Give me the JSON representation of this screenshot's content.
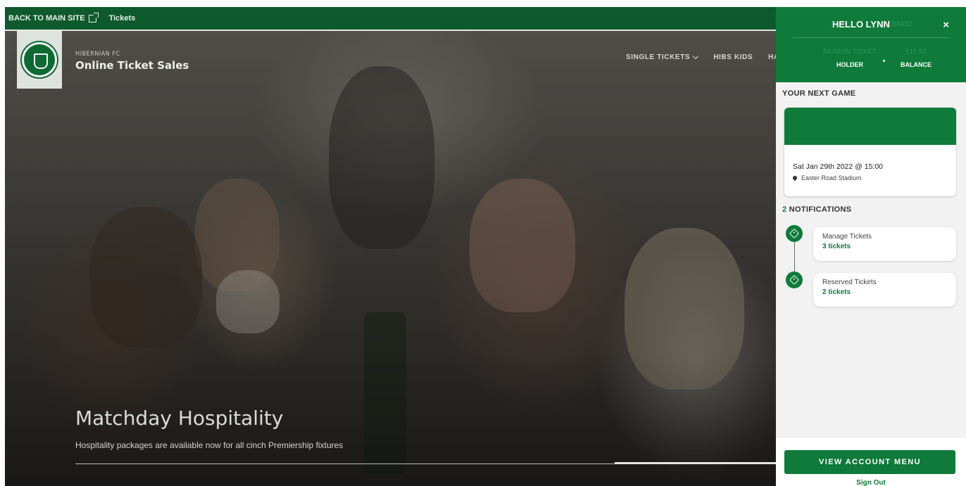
{
  "topbar": {
    "back_label": "BACK TO MAIN SITE",
    "tickets_label": "Tickets"
  },
  "brand": {
    "club": "HIBERNIAN FC",
    "title": "Online Ticket Sales"
  },
  "nav": {
    "items": [
      "SINGLE TICKETS",
      "HIBS KIDS",
      "HALF S"
    ]
  },
  "hero": {
    "title": "Matchday Hospitality",
    "subtitle": "Hospitality packages are available now for all cinch Premiership fixtures"
  },
  "panel": {
    "greeting": "HELLO LYNN",
    "user_id": "166462",
    "close": "×",
    "stats": [
      {
        "faint": "SEASON TICKET",
        "label": "HOLDER"
      },
      {
        "faint": "£12.50",
        "label": "BALANCE"
      }
    ],
    "next_game_heading": "YOUR NEXT GAME",
    "next_game": {
      "date": "Sat Jan 29th 2022 @ 15:00",
      "venue": "Easter Road Stadium"
    },
    "notifications_count": "2",
    "notifications_heading": "NOTIFICATIONS",
    "notifications": [
      {
        "title": "Manage Tickets",
        "count": "3 tickets"
      },
      {
        "title": "Reserved Tickets",
        "count": "2 tickets"
      }
    ],
    "menu_button": "VIEW ACCOUNT MENU",
    "sign_out": "Sign Out"
  },
  "colors": {
    "brand_green": "#0f7a3a",
    "topbar_green": "#0f5a2c",
    "panel_bg": "#f2f2f2"
  },
  "icons": [
    "external-link-icon",
    "chevron-down-icon",
    "close-icon",
    "location-pin-icon",
    "ticket-tag-icon"
  ]
}
